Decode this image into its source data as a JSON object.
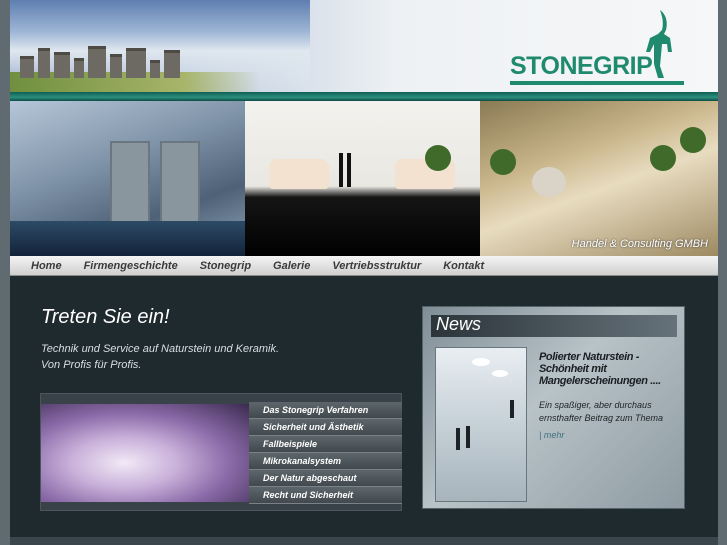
{
  "brand": {
    "name": "STONEGRIP"
  },
  "hero": {
    "caption": "Handel & Consulting GMBH"
  },
  "nav": {
    "items": [
      "Home",
      "Firmengeschichte",
      "Stonegrip",
      "Galerie",
      "Vertriebsstruktur",
      "Kontakt"
    ]
  },
  "main": {
    "title": "Treten Sie ein!",
    "intro_line1": "Technik und Service auf Naturstein und Keramik.",
    "intro_line2": "Von Profis für Profis."
  },
  "feature_menu": {
    "items": [
      "Das Stonegrip Verfahren",
      "Sicherheit und Ästhetik",
      "Fallbeispiele",
      "Mikrokanalsystem",
      "Der Natur abgeschaut",
      "Recht und Sicherheit"
    ]
  },
  "news": {
    "title": "News",
    "headline": "Polierter Naturstein - Schönheit mit Mangelerscheinungen ....",
    "text": "Ein spaßiger, aber durchaus ernsthafter Beitrag zum Thema",
    "more_link": "| mehr"
  },
  "colors": {
    "accent_teal": "#1f8a6e",
    "background": "#1f2a2f",
    "nav_bg": "#e2e2e2"
  }
}
